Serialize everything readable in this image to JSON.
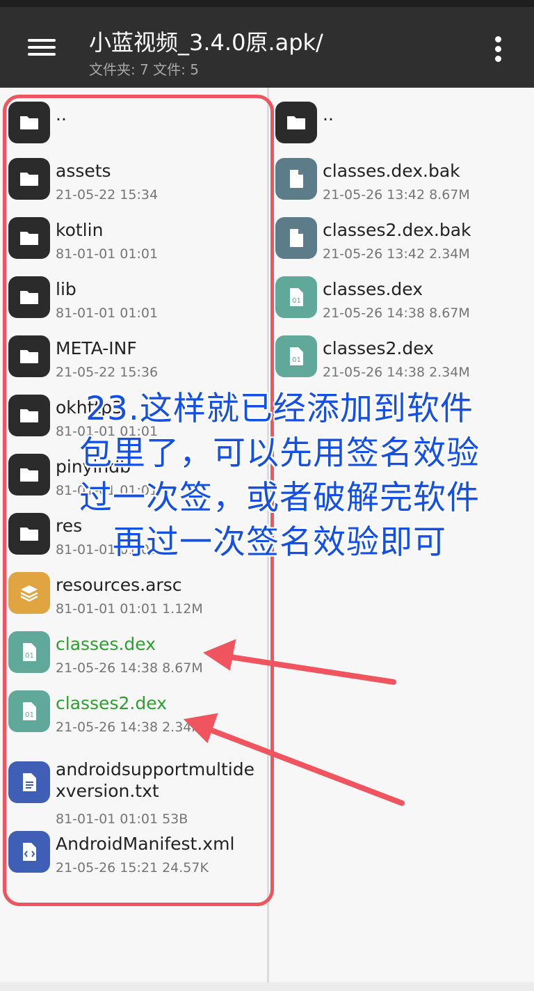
{
  "toolbar": {
    "title": "小蓝视频_3.4.0原.apk/",
    "subtitle": "文件夹: 7  文件: 5"
  },
  "left_pane": {
    "items": [
      {
        "name": "..",
        "meta": "",
        "icon": "folder-icon"
      },
      {
        "name": "assets",
        "meta": "21-05-22 15:34",
        "icon": "folder-icon"
      },
      {
        "name": "kotlin",
        "meta": "81-01-01 01:01",
        "icon": "folder-icon"
      },
      {
        "name": "lib",
        "meta": "81-01-01 01:01",
        "icon": "folder-icon"
      },
      {
        "name": "META-INF",
        "meta": "21-05-22 15:36",
        "icon": "folder-icon"
      },
      {
        "name": "okhttp3",
        "meta": "81-01-01 01:01",
        "icon": "folder-icon"
      },
      {
        "name": "pinyindb",
        "meta": "81-01-01 01:01",
        "icon": "folder-icon"
      },
      {
        "name": "res",
        "meta": "81-01-01 01:01",
        "icon": "folder-icon"
      },
      {
        "name": "resources.arsc",
        "meta": "81-01-01 01:01  1.12M",
        "icon": "layers-icon"
      },
      {
        "name": "classes.dex",
        "meta": "21-05-26 14:38  8.67M",
        "icon": "binary-file-icon"
      },
      {
        "name": "classes2.dex",
        "meta": "21-05-26 14:38  2.34M",
        "icon": "binary-file-icon"
      },
      {
        "name": "androidsupportmultidexversion.txt",
        "meta": "81-01-01 01:01  53B",
        "icon": "text-file-icon"
      },
      {
        "name": "AndroidManifest.xml",
        "meta": "21-05-26 15:21  24.57K",
        "icon": "code-file-icon"
      }
    ]
  },
  "right_pane": {
    "items": [
      {
        "name": "..",
        "meta": "",
        "icon": "folder-icon"
      },
      {
        "name": "classes.dex.bak",
        "meta": "21-05-26 13:42  8.67M",
        "icon": "file-icon"
      },
      {
        "name": "classes2.dex.bak",
        "meta": "21-05-26 13:42  2.34M",
        "icon": "file-icon"
      },
      {
        "name": "classes.dex",
        "meta": "21-05-26 14:38  8.67M",
        "icon": "binary-file-icon"
      },
      {
        "name": "classes2.dex",
        "meta": "21-05-26 14:38  2.34M",
        "icon": "binary-file-icon"
      }
    ]
  },
  "overlay": {
    "lines": [
      "23.这样就已经添加到软件",
      "包里了，可以先用签名效验",
      "过一次签，或者破解完软件",
      "再过一次签名效验即可"
    ],
    "color": "#1450e6"
  },
  "highlight_color": "#f0545e",
  "binary_icon_text": "01"
}
